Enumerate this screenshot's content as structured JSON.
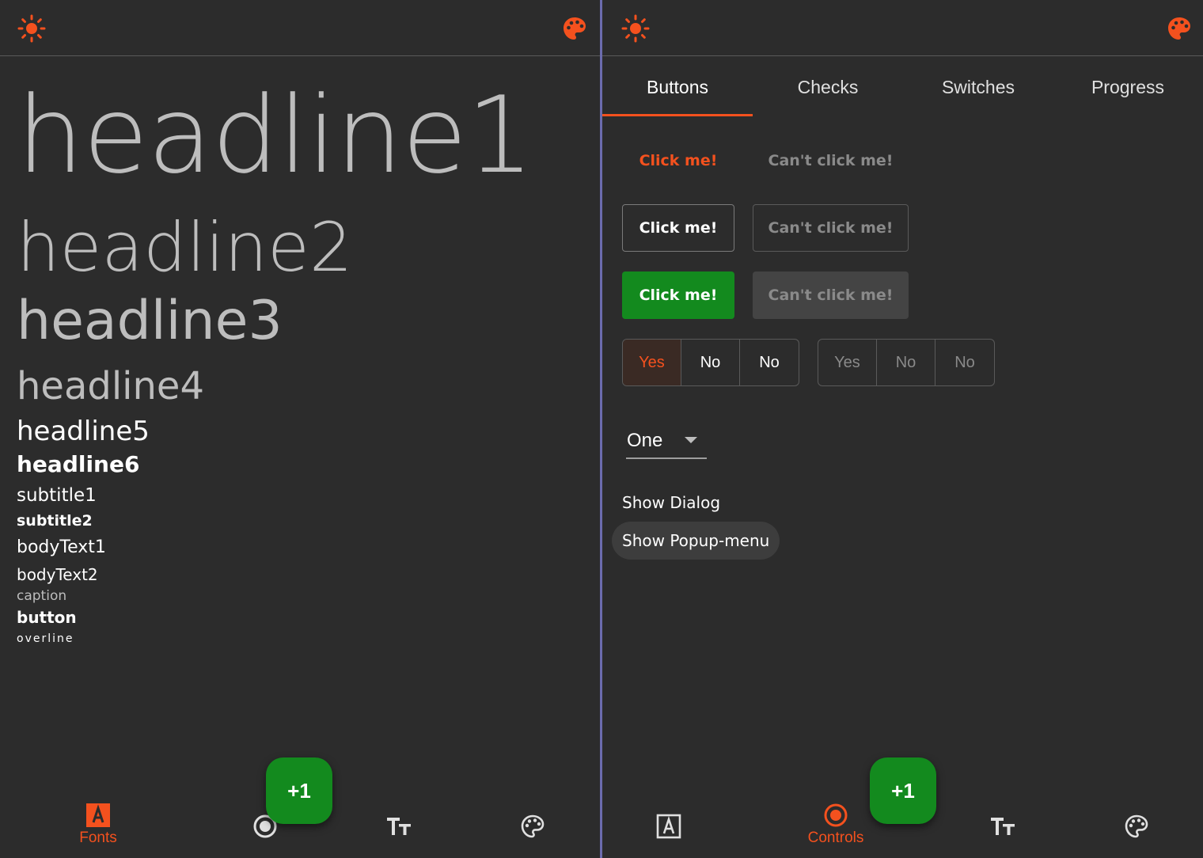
{
  "colors": {
    "accent": "#f4511e",
    "fab": "#138a1e",
    "background": "#2c2c2c",
    "divider": "#6c6cae"
  },
  "left": {
    "appbar": {
      "left_icon": "brightness-icon",
      "right_icon": "palette-icon"
    },
    "typography": {
      "headline1": "headline1",
      "headline2": "headline2",
      "headline3": "headline3",
      "headline4": "headline4",
      "headline5": "headline5",
      "headline6": "headline6",
      "subtitle1": "subtitle1",
      "subtitle2": "subtitle2",
      "bodyText1": "bodyText1",
      "bodyText2": "bodyText2",
      "caption": "caption",
      "button": "button",
      "overline": "overline"
    },
    "fab_label": "+1",
    "bottom_nav": [
      {
        "icon": "font-icon",
        "label": "Fonts",
        "active": true
      },
      {
        "icon": "radio-button-icon",
        "label": "",
        "active": false
      },
      {
        "icon": "text-size-icon",
        "label": "",
        "active": false
      },
      {
        "icon": "palette-icon",
        "label": "",
        "active": false
      }
    ]
  },
  "right": {
    "appbar": {
      "left_icon": "brightness-icon",
      "right_icon": "palette-icon"
    },
    "tabs": [
      {
        "label": "Buttons",
        "active": true
      },
      {
        "label": "Checks",
        "active": false
      },
      {
        "label": "Switches",
        "active": false
      },
      {
        "label": "Progress",
        "active": false
      }
    ],
    "buttons": {
      "enabled_label": "Click me!",
      "disabled_label": "Can't click me!"
    },
    "toggle_enabled": [
      "Yes",
      "No",
      "No"
    ],
    "toggle_disabled": [
      "Yes",
      "No",
      "No"
    ],
    "dropdown": {
      "value": "One"
    },
    "show_dialog": "Show Dialog",
    "show_popup": "Show Popup-menu",
    "fab_label": "+1",
    "bottom_nav": [
      {
        "icon": "font-icon",
        "label": "",
        "active": false
      },
      {
        "icon": "radio-button-icon",
        "label": "Controls",
        "active": true
      },
      {
        "icon": "text-size-icon",
        "label": "",
        "active": false
      },
      {
        "icon": "palette-icon",
        "label": "",
        "active": false
      }
    ]
  }
}
